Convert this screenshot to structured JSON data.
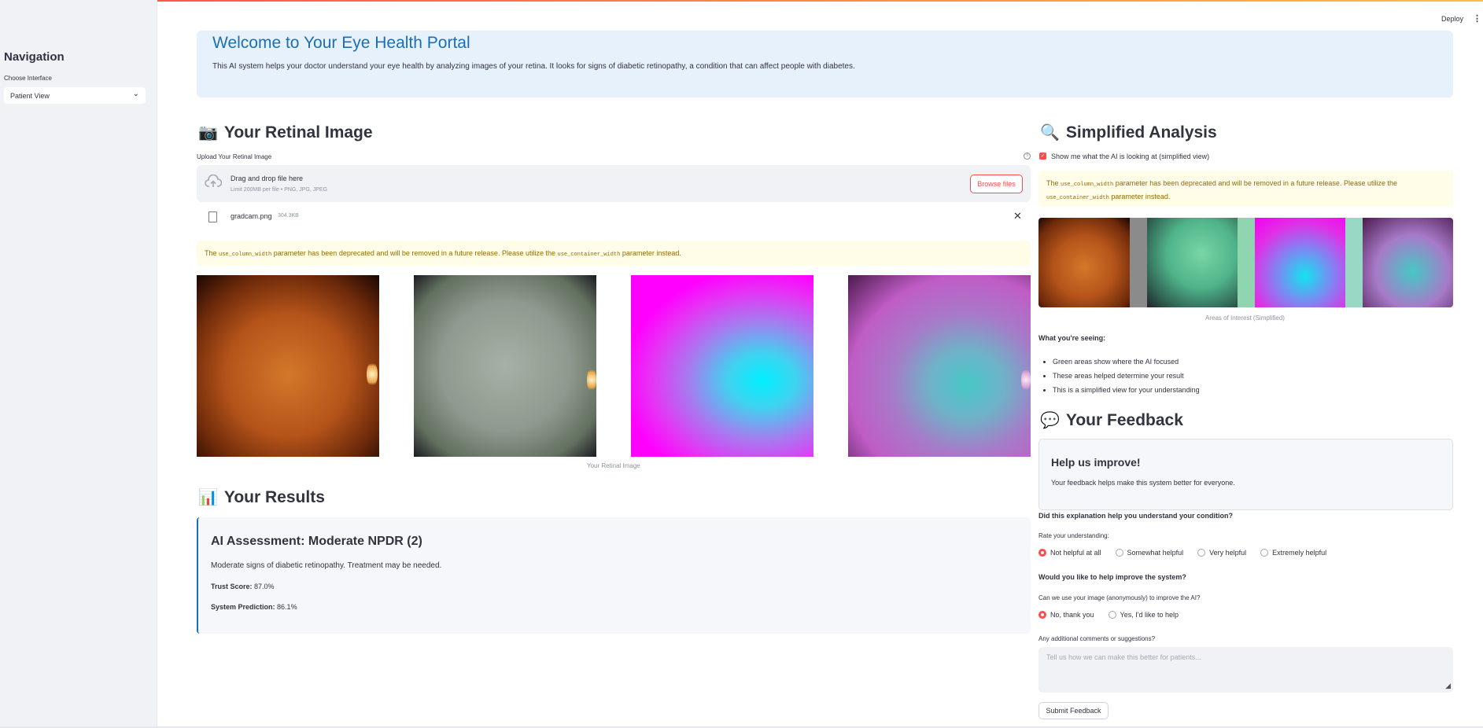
{
  "app": {
    "deploy_label": "Deploy",
    "menu_glyph": "⋮"
  },
  "sidebar": {
    "title": "Navigation",
    "select_label": "Choose Interface",
    "select_value": "Patient View",
    "select_chevron": "⌄"
  },
  "welcome": {
    "title": "Welcome to Your Eye Health Portal",
    "body": "This AI system helps your doctor understand your eye health by analyzing images of your retina. It looks for signs of diabetic retinopathy, a condition that can affect people with diabetes."
  },
  "retinal": {
    "emoji": "📷",
    "title": "Your Retinal Image",
    "upload_label": "Upload Your Retinal Image",
    "help_glyph": "?",
    "drop_title": "Drag and drop file here",
    "drop_sub": "Limit 200MB per file • PNG, JPG, JPEG",
    "browse_label": "Browse files",
    "file_name": "gradcam.png",
    "file_size": "304.3KB",
    "close_glyph": "✕",
    "warn_pre": "The",
    "warn_code1": "use_column_width",
    "warn_mid": "parameter has been deprecated and will be removed in a future release. Please utilize the",
    "warn_code2": "use_container_width",
    "warn_post": "parameter instead.",
    "caption": "Your Retinal Image"
  },
  "results": {
    "emoji": "📊",
    "title": "Your Results",
    "assessment": "AI Assessment: Moderate NPDR (2)",
    "description": "Moderate signs of diabetic retinopathy. Treatment may be needed.",
    "trust_label": "Trust Score:",
    "trust_value": "87.0%",
    "prediction_label": "System Prediction:",
    "prediction_value": "86.1%"
  },
  "analysis": {
    "emoji": "🔍",
    "title": "Simplified Analysis",
    "checkbox_label": "Show me what the AI is looking at (simplified view)",
    "checkbox_checked": true,
    "warn_pre": "The",
    "warn_code1": "use_column_width",
    "warn_mid": "parameter has been deprecated and will be removed in a future release. Please utilize the",
    "warn_code2": "use_container_width",
    "warn_post": "parameter instead.",
    "caption": "Areas of Interest (Simplified)",
    "seeing_title": "What you're seeing:",
    "seeing_items": [
      "Green areas show where the AI focused",
      "These areas helped determine your result",
      "This is a simplified view for your understanding"
    ]
  },
  "feedback": {
    "emoji": "💬",
    "title": "Your Feedback",
    "card_title": "Help us improve!",
    "card_body": "Your feedback helps make this system better for everyone.",
    "q1": "Did this explanation help you understand your condition?",
    "q1_label": "Rate your understanding:",
    "q1_options": [
      "Not helpful at all",
      "Somewhat helpful",
      "Very helpful",
      "Extremely helpful"
    ],
    "q1_selected": 0,
    "q2": "Would you like to help improve the system?",
    "q2_label": "Can we use your image (anonymously) to improve the AI?",
    "q2_options": [
      "No, thank you",
      "Yes, I'd like to help"
    ],
    "q2_selected": 0,
    "comments_label": "Any additional comments or suggestions?",
    "comments_placeholder": "Tell us how we can make this better for patients...",
    "submit_label": "Submit Feedback"
  },
  "colors": {
    "accent": "#ff4b4b",
    "title_blue": "#1c6fb2",
    "info_bg": "#e7f1fb",
    "warn_bg": "#fffce7",
    "warn_text": "#926c05"
  }
}
